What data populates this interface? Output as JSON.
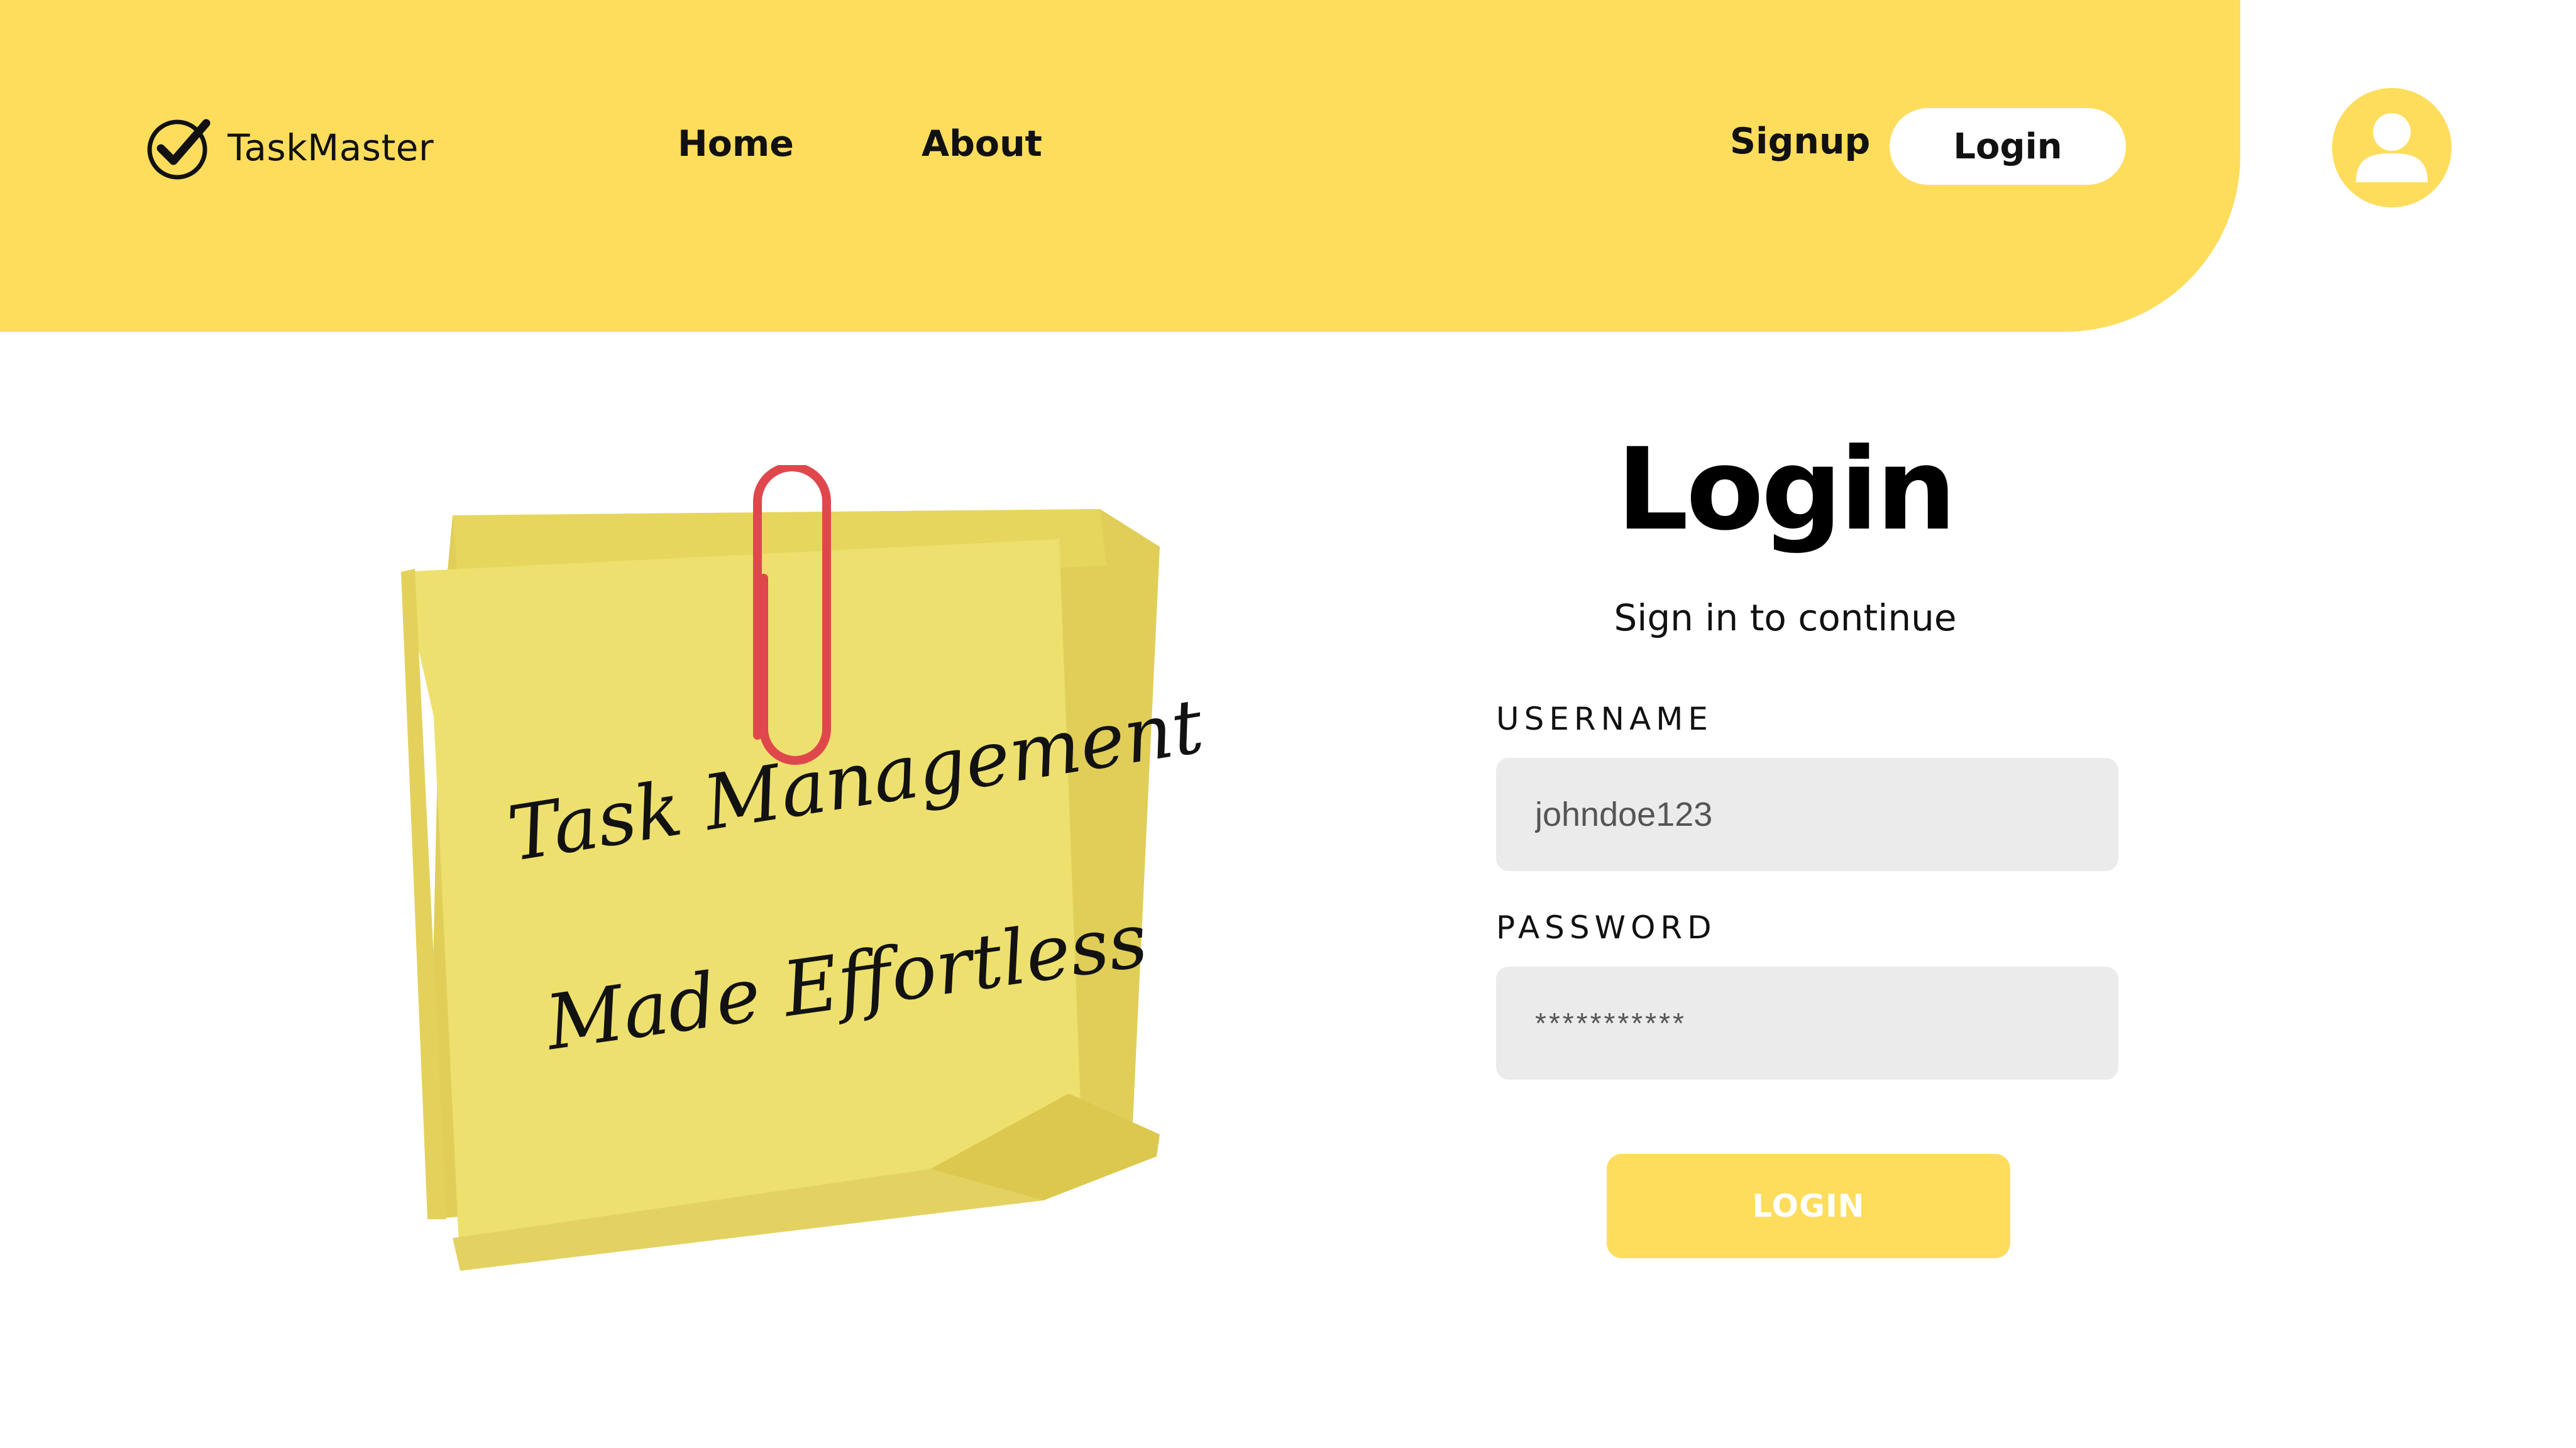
{
  "brand": {
    "name": "TaskMaster",
    "icon": "check-circle-icon"
  },
  "nav": {
    "home": "Home",
    "about": "About",
    "signup": "Signup",
    "login": "Login"
  },
  "avatar": {
    "icon": "user-icon"
  },
  "illustration": {
    "note_line_1": "Task Management",
    "note_line_2": "Made Effortless",
    "icons": [
      "sticky-note",
      "paperclip"
    ]
  },
  "login_form": {
    "title": "Login",
    "subtitle": "Sign in to continue",
    "username_label": "USERNAME",
    "username_value": "johndoe123",
    "password_label": "PASSWORD",
    "password_value": "***********",
    "submit_label": "LOGIN"
  },
  "colors": {
    "accent_yellow": "#fedd5d",
    "note_yellow": "#ede06f",
    "note_shadow": "#d8c54d",
    "paperclip_red": "#e0474c",
    "input_bg": "#ebebeb",
    "text_dark": "#111111"
  }
}
